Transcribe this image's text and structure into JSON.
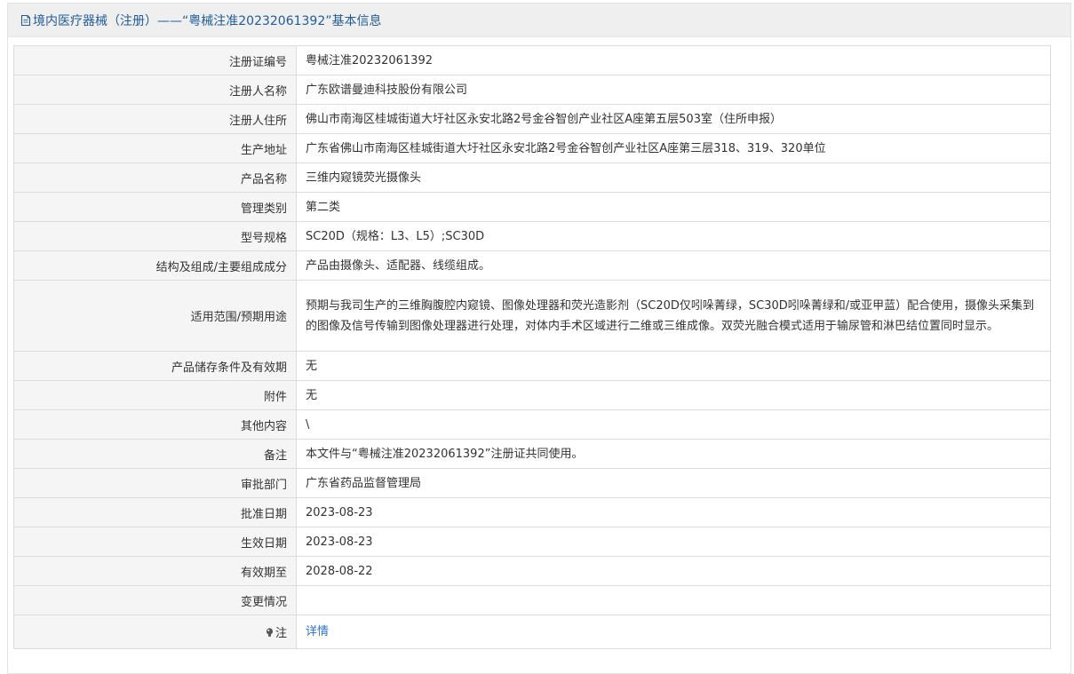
{
  "header": {
    "title": "境内医疗器械（注册）——“粤械注准20232061392”基本信息",
    "icon": "document-icon",
    "accent_color": "#1f5c99"
  },
  "rows": [
    {
      "label": "注册证编号",
      "value": "粤械注准20232061392"
    },
    {
      "label": "注册人名称",
      "value": "广东欧谱曼迪科技股份有限公司"
    },
    {
      "label": "注册人住所",
      "value": "佛山市南海区桂城街道大圩社区永安北路2号金谷智创产业社区A座第五层503室（住所申报）"
    },
    {
      "label": "生产地址",
      "value": "广东省佛山市南海区桂城街道大圩社区永安北路2号金谷智创产业社区A座第三层318、319、320单位"
    },
    {
      "label": "产品名称",
      "value": "三维内窥镜荧光摄像头"
    },
    {
      "label": "管理类别",
      "value": "第二类"
    },
    {
      "label": "型号规格",
      "value": "SC20D（规格：L3、L5）;SC30D"
    },
    {
      "label": "结构及组成/主要组成成分",
      "value": "产品由摄像头、适配器、线缆组成。"
    },
    {
      "label": "适用范围/预期用途",
      "value": "预期与我司生产的三维胸腹腔内窥镜、图像处理器和荧光造影剂（SC20D仅吲哚菁绿，SC30D吲哚菁绿和/或亚甲蓝）配合使用，摄像头采集到的图像及信号传输到图像处理器进行处理，对体内手术区域进行二维或三维成像。双荧光融合模式适用于输尿管和淋巴结位置同时显示。"
    },
    {
      "label": "产品储存条件及有效期",
      "value": "无"
    },
    {
      "label": "附件",
      "value": "无"
    },
    {
      "label": "其他内容",
      "value": "\\"
    },
    {
      "label": "备注",
      "value": "本文件与“粤械注准20232061392”注册证共同使用。"
    },
    {
      "label": "审批部门",
      "value": "广东省药品监督管理局"
    },
    {
      "label": "批准日期",
      "value": "2023-08-23"
    },
    {
      "label": "生效日期",
      "value": "2023-08-23"
    },
    {
      "label": "有效期至",
      "value": "2028-08-22"
    },
    {
      "label": "变更情况",
      "value": ""
    }
  ],
  "note_row": {
    "label": "注",
    "icon": "info-bulb-icon",
    "link_text": "详情",
    "link_color": "#2a72c9"
  }
}
